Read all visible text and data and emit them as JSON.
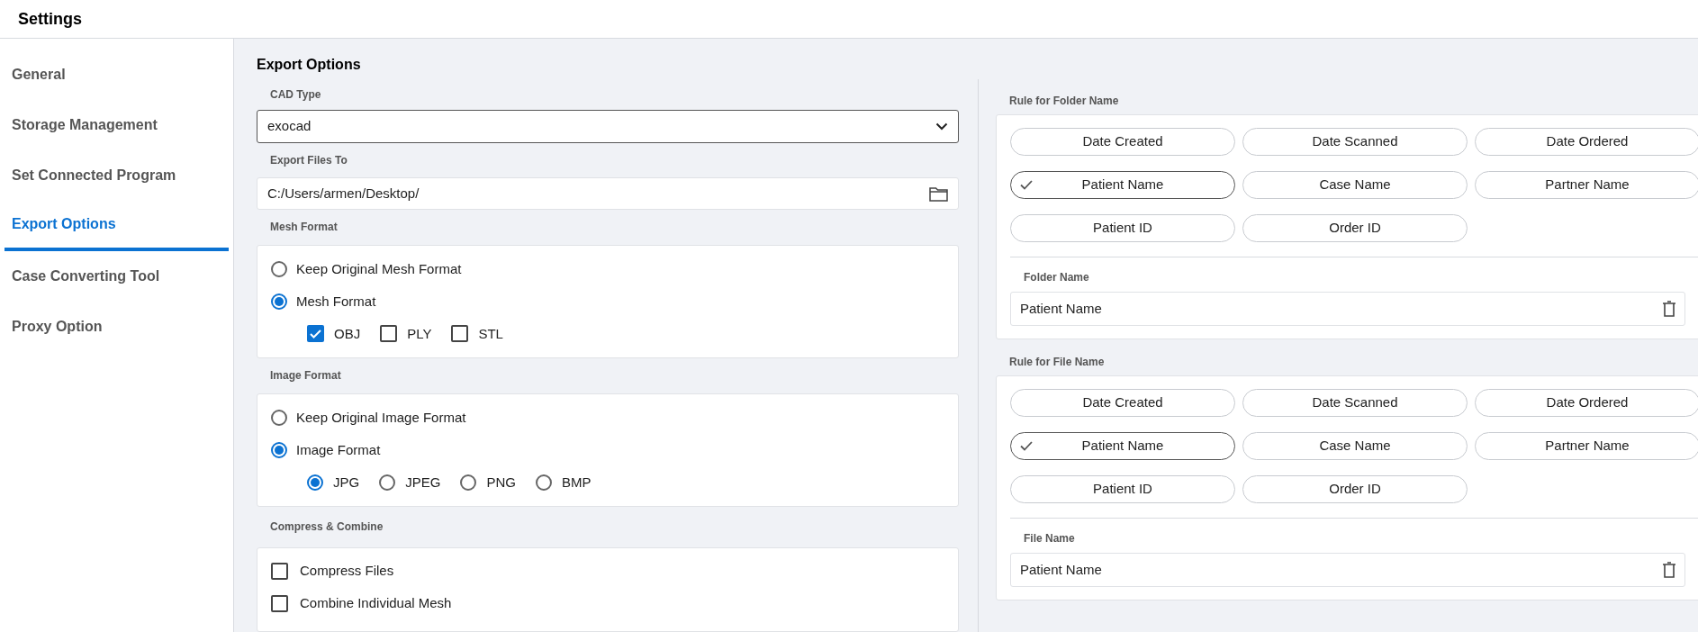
{
  "window": {
    "title": "Settings"
  },
  "sidebar": {
    "items": [
      {
        "label": "General",
        "selected": false
      },
      {
        "label": "Storage Management",
        "selected": false
      },
      {
        "label": "Set Connected Program",
        "selected": false
      },
      {
        "label": "Export Options",
        "selected": true
      },
      {
        "label": "Case Converting Tool",
        "selected": false
      },
      {
        "label": "Proxy Option",
        "selected": false
      }
    ]
  },
  "page_title": "Export Options",
  "cad_type": {
    "label": "CAD Type",
    "value": "exocad"
  },
  "export_path": {
    "label": "Export Files To",
    "value": "C:/Users/armen/Desktop/"
  },
  "mesh_format": {
    "label": "Mesh Format",
    "options": [
      {
        "label": "Keep Original Mesh Format",
        "selected": false
      },
      {
        "label": "Mesh Format",
        "selected": true
      }
    ],
    "formats": [
      {
        "label": "OBJ",
        "checked": true
      },
      {
        "label": "PLY",
        "checked": false
      },
      {
        "label": "STL",
        "checked": false
      }
    ]
  },
  "image_format": {
    "label": "Image Format",
    "options": [
      {
        "label": "Keep Original Image Format",
        "selected": false
      },
      {
        "label": "Image Format",
        "selected": true
      }
    ],
    "formats": [
      {
        "label": "JPG",
        "selected": true
      },
      {
        "label": "JPEG",
        "selected": false
      },
      {
        "label": "PNG",
        "selected": false
      },
      {
        "label": "BMP",
        "selected": false
      }
    ]
  },
  "compress_combine": {
    "label": "Compress & Combine",
    "options": [
      {
        "label": "Compress Files",
        "checked": false
      },
      {
        "label": "Combine Individual Mesh",
        "checked": false
      }
    ]
  },
  "folder_rule": {
    "label": "Rule for Folder Name",
    "tokens": [
      {
        "label": "Date Created",
        "selected": false
      },
      {
        "label": "Date Scanned",
        "selected": false
      },
      {
        "label": "Date Ordered",
        "selected": false
      },
      {
        "label": "Patient Name",
        "selected": true
      },
      {
        "label": "Case Name",
        "selected": false
      },
      {
        "label": "Partner Name",
        "selected": false
      },
      {
        "label": "Patient ID",
        "selected": false
      },
      {
        "label": "Order ID",
        "selected": false
      }
    ],
    "result_label": "Folder Name",
    "result_value": "Patient Name"
  },
  "file_rule": {
    "label": "Rule for File Name",
    "tokens": [
      {
        "label": "Date Created",
        "selected": false
      },
      {
        "label": "Date Scanned",
        "selected": false
      },
      {
        "label": "Date Ordered",
        "selected": false
      },
      {
        "label": "Patient Name",
        "selected": true
      },
      {
        "label": "Case Name",
        "selected": false
      },
      {
        "label": "Partner Name",
        "selected": false
      },
      {
        "label": "Patient ID",
        "selected": false
      },
      {
        "label": "Order ID",
        "selected": false
      }
    ],
    "result_label": "File Name",
    "result_value": "Patient Name"
  }
}
